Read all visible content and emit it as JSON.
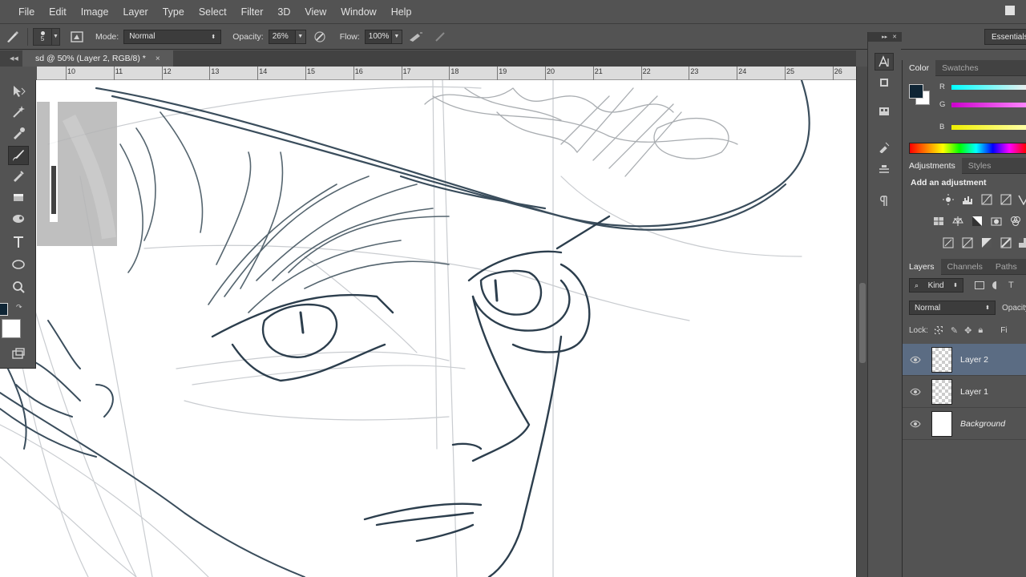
{
  "menu": [
    "File",
    "Edit",
    "Image",
    "Layer",
    "Type",
    "Select",
    "Filter",
    "3D",
    "View",
    "Window",
    "Help"
  ],
  "options": {
    "brush_size": "5",
    "mode_label": "Mode:",
    "mode_value": "Normal",
    "opacity_label": "Opacity:",
    "opacity_value": "26%",
    "flow_label": "Flow:",
    "flow_value": "100%",
    "workspace": "Essentials"
  },
  "document": {
    "tab_title": "sd @ 50% (Layer 2, RGB/8) *",
    "close": "×"
  },
  "ruler": {
    "ticks": [
      "10",
      "11",
      "12",
      "13",
      "14",
      "15",
      "16",
      "17",
      "18",
      "19",
      "20",
      "21",
      "22",
      "23",
      "24",
      "25",
      "26"
    ]
  },
  "colors": {
    "foreground": "#0f2535",
    "background": "#ffffff",
    "layer_selected": "#5b6c83"
  },
  "panels": {
    "color_tabs": [
      "Color",
      "Swatches"
    ],
    "channels": [
      "R",
      "G",
      "B"
    ],
    "adjust_tabs": [
      "Adjustments",
      "Styles"
    ],
    "adjust_title": "Add an adjustment",
    "layers_tabs": [
      "Layers",
      "Channels",
      "Paths"
    ],
    "filter_kind": "Kind",
    "blend_mode": "Normal",
    "opacity_short": "Opacity",
    "lock_label": "Lock:",
    "fill_short": "Fi"
  },
  "layers": [
    {
      "name": "Layer 2",
      "selected": true,
      "transparent": true,
      "italic": false
    },
    {
      "name": "Layer 1",
      "selected": false,
      "transparent": true,
      "italic": false
    },
    {
      "name": "Background",
      "selected": false,
      "transparent": false,
      "italic": true
    }
  ],
  "icons": {
    "brush_tool": "brush-icon",
    "airbrush": "airbrush-icon",
    "visibility": "eye-icon"
  }
}
